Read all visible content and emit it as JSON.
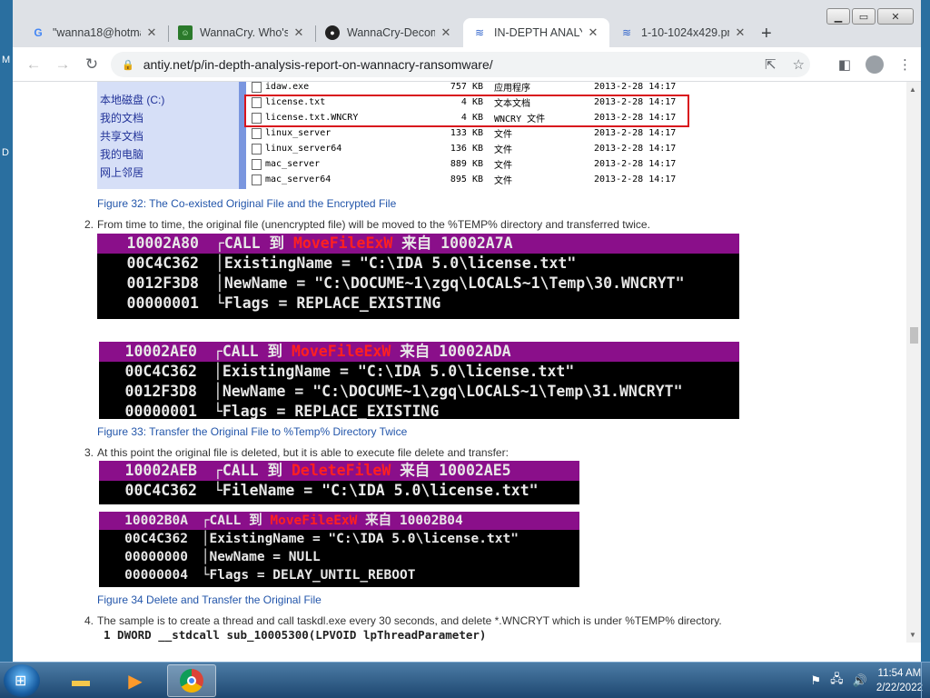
{
  "browser": {
    "tabs": [
      {
        "title": "\"wanna18@hotmai",
        "favicon": "google-icon",
        "active": false
      },
      {
        "title": "WannaCry. Who's",
        "favicon": "wannacry-icon",
        "active": false
      },
      {
        "title": "WannaCry-Decom",
        "favicon": "github-icon",
        "active": false
      },
      {
        "title": "IN-DEPTH ANALYS",
        "favicon": "antiy-icon",
        "active": true
      },
      {
        "title": "1-10-1024x429.pn",
        "favicon": "antiy-icon",
        "active": false
      }
    ],
    "url": "antiy.net/p/in-depth-analysis-report-on-wannacry-ransomware/"
  },
  "explorer": {
    "sidebar": [
      "本地磁盘 (C:)",
      "我的文档",
      "共享文档",
      "我的电脑",
      "网上邻居"
    ],
    "files": [
      {
        "name": "idaw.exe",
        "size": "757 KB",
        "type": "应用程序",
        "date": "2013-2-28 14:17"
      },
      {
        "name": "license.txt",
        "size": "4 KB",
        "type": "文本文档",
        "date": "2013-2-28 14:17"
      },
      {
        "name": "license.txt.WNCRY",
        "size": "4 KB",
        "type": "WNCRY 文件",
        "date": "2013-2-28 14:17"
      },
      {
        "name": "linux_server",
        "size": "133 KB",
        "type": "文件",
        "date": "2013-2-28 14:17"
      },
      {
        "name": "linux_server64",
        "size": "136 KB",
        "type": "文件",
        "date": "2013-2-28 14:17"
      },
      {
        "name": "mac_server",
        "size": "889 KB",
        "type": "文件",
        "date": "2013-2-28 14:17"
      },
      {
        "name": "mac_server64",
        "size": "895 KB",
        "type": "文件",
        "date": "2013-2-28 14:17"
      }
    ]
  },
  "content": {
    "fig32": "Figure 32: The Co-existed Original File and the Encrypted File",
    "p2_num": "2.",
    "p2": "From time to time, the original file (unencrypted file) will be moved to the %TEMP% directory and transferred twice.",
    "fig33": "Figure 33: Transfer the Original File to %Temp% Directory Twice",
    "p3_num": "3.",
    "p3": "At this point the original file is deleted, but it is able to execute file delete and transfer:",
    "fig34": "Figure 34 Delete and Transfer the Original File",
    "p4_num": "4.",
    "p4": "The sample is to create a thread and call taskdl.exe every 30 seconds, and delete *.WNCRYT which is under %TEMP% directory.",
    "code_line": "1 DWORD __stdcall sub_10005300(LPVOID lpThreadParameter)"
  },
  "debug": {
    "block1": {
      "addr": "10002A80",
      "call": "CALL 到",
      "fn": "MoveFileExW",
      "from": "来自",
      "caller": "10002A7A",
      "rows": [
        {
          "addr": "00C4C362",
          "text": "ExistingName = \"C:\\IDA 5.0\\license.txt\""
        },
        {
          "addr": "0012F3D8",
          "text": "NewName = \"C:\\DOCUME~1\\zgq\\LOCALS~1\\Temp\\30.WNCRYT\""
        },
        {
          "addr": "00000001",
          "text": "Flags = REPLACE_EXISTING"
        }
      ]
    },
    "block2": {
      "addr": "10002AE0",
      "call": "CALL 到",
      "fn": "MoveFileExW",
      "from": "来自",
      "caller": "10002ADA",
      "rows": [
        {
          "addr": "00C4C362",
          "text": "ExistingName = \"C:\\IDA 5.0\\license.txt\""
        },
        {
          "addr": "0012F3D8",
          "text": "NewName = \"C:\\DOCUME~1\\zgq\\LOCALS~1\\Temp\\31.WNCRYT\""
        },
        {
          "addr": "00000001",
          "text": "Flags = REPLACE_EXISTING"
        }
      ]
    },
    "block3": {
      "addr": "10002AEB",
      "call": "CALL 到",
      "fn": "DeleteFileW",
      "from": "来自",
      "caller": "10002AE5",
      "rows": [
        {
          "addr": "00C4C362",
          "text": "FileName = \"C:\\IDA 5.0\\license.txt\""
        }
      ]
    },
    "block4": {
      "addr": "10002B0A",
      "call": "CALL 到",
      "fn": "MoveFileExW",
      "from": "来自",
      "caller": "10002B04",
      "rows": [
        {
          "addr": "00C4C362",
          "text": "ExistingName = \"C:\\IDA 5.0\\license.txt\""
        },
        {
          "addr": "00000000",
          "text": "NewName = NULL"
        },
        {
          "addr": "00000004",
          "text": "Flags = DELAY_UNTIL_REBOOT"
        }
      ]
    }
  },
  "taskbar": {
    "time": "11:54 AM",
    "date": "2/22/2022"
  },
  "colors": {
    "accent": "#2255aa",
    "debug_header": "#8a0f8a",
    "debug_fn": "#ff2020",
    "redbox": "#d9141d"
  }
}
